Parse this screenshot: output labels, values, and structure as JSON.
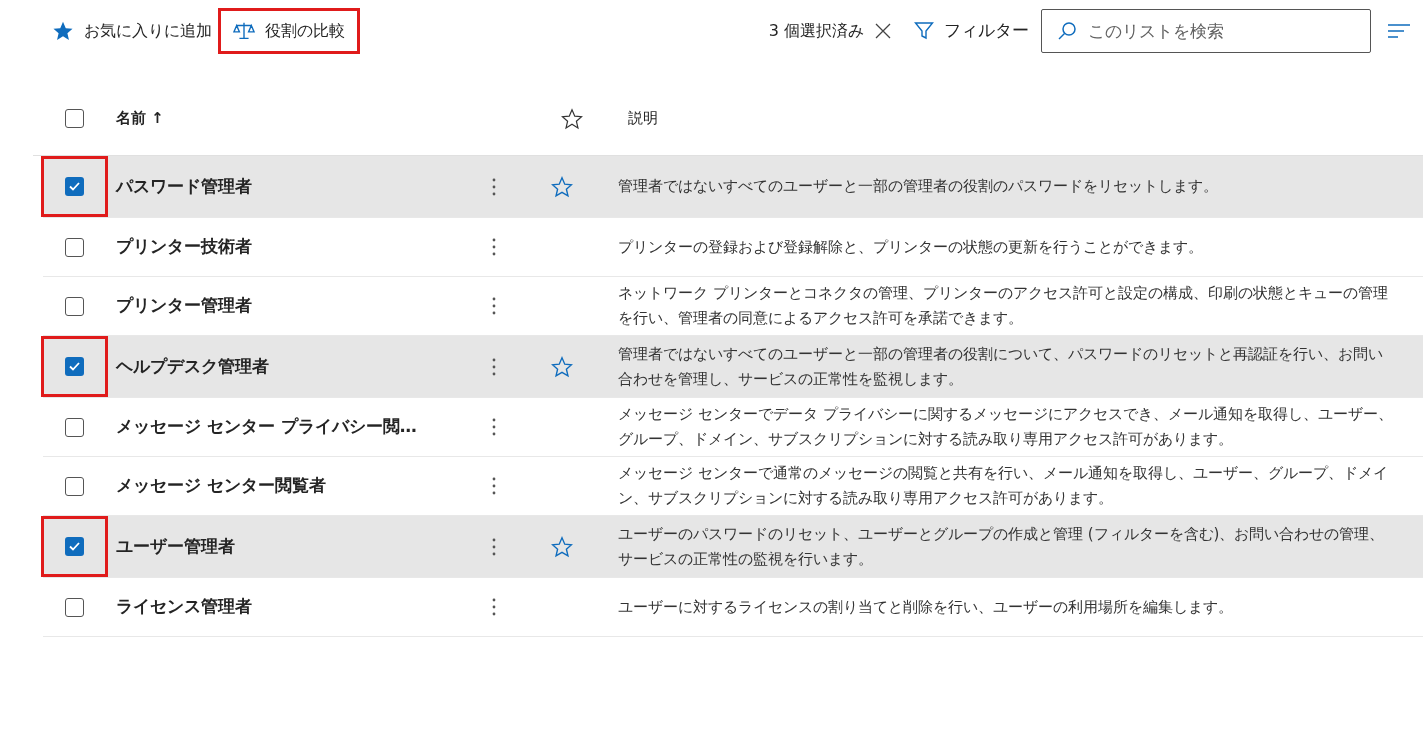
{
  "toolbar": {
    "favorite_button": "お気に入りに追加",
    "compare_button": {
      "label": "役割の比較",
      "highlighted": true
    },
    "selection_count": "3 個選択済み",
    "filter_button": "フィルター",
    "search": {
      "placeholder": "このリストを検索"
    }
  },
  "table": {
    "header": {
      "checked": false,
      "name": "名前 ↑",
      "description": "説明"
    },
    "rows": [
      {
        "name": "パスワード管理者",
        "description": "管理者ではないすべてのユーザーと一部の管理者の役割のパスワードをリセットします。",
        "selected": true,
        "favorite": true,
        "highlighted": true
      },
      {
        "name": "プリンター技術者",
        "description": "プリンターの登録および登録解除と、プリンターの状態の更新を行うことができます。",
        "selected": false,
        "favorite": false,
        "highlighted": false
      },
      {
        "name": "プリンター管理者",
        "description": "ネットワーク プリンターとコネクタの管理、プリンターのアクセス許可と設定の構成、印刷の状態とキューの管理を行い、管理者の同意によるアクセス許可を承諾できます。",
        "selected": false,
        "favorite": false,
        "highlighted": false
      },
      {
        "name": "ヘルプデスク管理者",
        "description": "管理者ではないすべてのユーザーと一部の管理者の役割について、パスワードのリセットと再認証を行い、お問い合わせを管理し、サービスの正常性を監視します。",
        "selected": true,
        "favorite": true,
        "highlighted": true
      },
      {
        "name": "メッセージ センター プライバシー閲…",
        "description": "メッセージ センターでデータ プライバシーに関するメッセージにアクセスでき、メール通知を取得し、ユーザー、グループ、ドメイン、サブスクリプションに対する読み取り専用アクセス許可があります。",
        "selected": false,
        "favorite": false,
        "highlighted": false
      },
      {
        "name": "メッセージ センター閲覧者",
        "description": "メッセージ センターで通常のメッセージの閲覧と共有を行い、メール通知を取得し、ユーザー、グループ、ドメイン、サブスクリプションに対する読み取り専用アクセス許可があります。",
        "selected": false,
        "favorite": false,
        "highlighted": false
      },
      {
        "name": "ユーザー管理者",
        "description": "ユーザーのパスワードのリセット、ユーザーとグループの作成と管理 (フィルターを含む)、お問い合わせの管理、サービスの正常性の監視を行います。",
        "selected": true,
        "favorite": true,
        "highlighted": true
      },
      {
        "name": "ライセンス管理者",
        "description": "ユーザーに対するライセンスの割り当てと削除を行い、ユーザーの利用場所を編集します。",
        "selected": false,
        "favorite": false,
        "highlighted": false
      }
    ]
  }
}
